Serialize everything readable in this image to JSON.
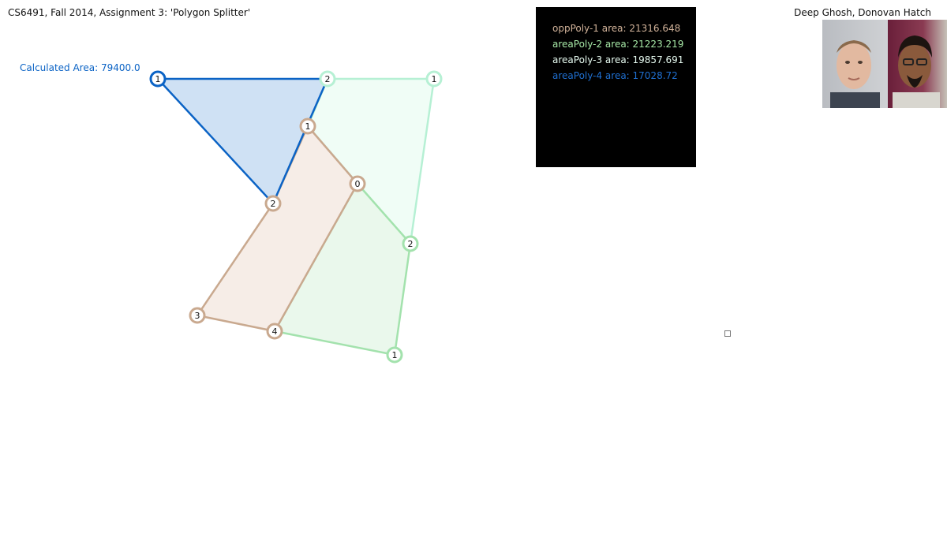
{
  "header": {
    "title": "CS6491, Fall 2014, Assignment 3: 'Polygon Splitter'",
    "authors": "Deep Ghosh, Donovan Hatch"
  },
  "calculated_area": "Calculated Area: 79400.0",
  "area_panel": {
    "lines": [
      {
        "text": "oppPoly-1 area: 21316.648",
        "color": "#d2b39a"
      },
      {
        "text": "areaPoly-2 area: 21223.219",
        "color": "#a6e8a6"
      },
      {
        "text": "areaPoly-3 area: 19857.691",
        "color": "#e6faf0"
      },
      {
        "text": "areaPoly-4 area: 17028.72",
        "color": "#1f6fd0"
      }
    ]
  },
  "colors": {
    "blue_stroke": "#0b63c5",
    "blue_fill": "#cfe1f4",
    "tan_stroke": "#c9a98f",
    "tan_fill": "#f6ede7",
    "green_stroke": "#a3e2ad",
    "green_fill": "#eaf8ec",
    "mint_stroke": "#b6f0d4",
    "mint_fill": "#f0fdf6"
  },
  "polygons": {
    "blue": {
      "vertex_labels": [
        "1",
        "2",
        "2"
      ]
    },
    "mint": {
      "vertex_labels": [
        "2",
        "1",
        "2",
        "0",
        "1"
      ]
    },
    "green": {
      "vertex_labels": [
        "0",
        "2",
        "1",
        "4"
      ]
    },
    "tan": {
      "vertex_labels": [
        "1",
        "0",
        "4",
        "3",
        "2"
      ]
    }
  }
}
